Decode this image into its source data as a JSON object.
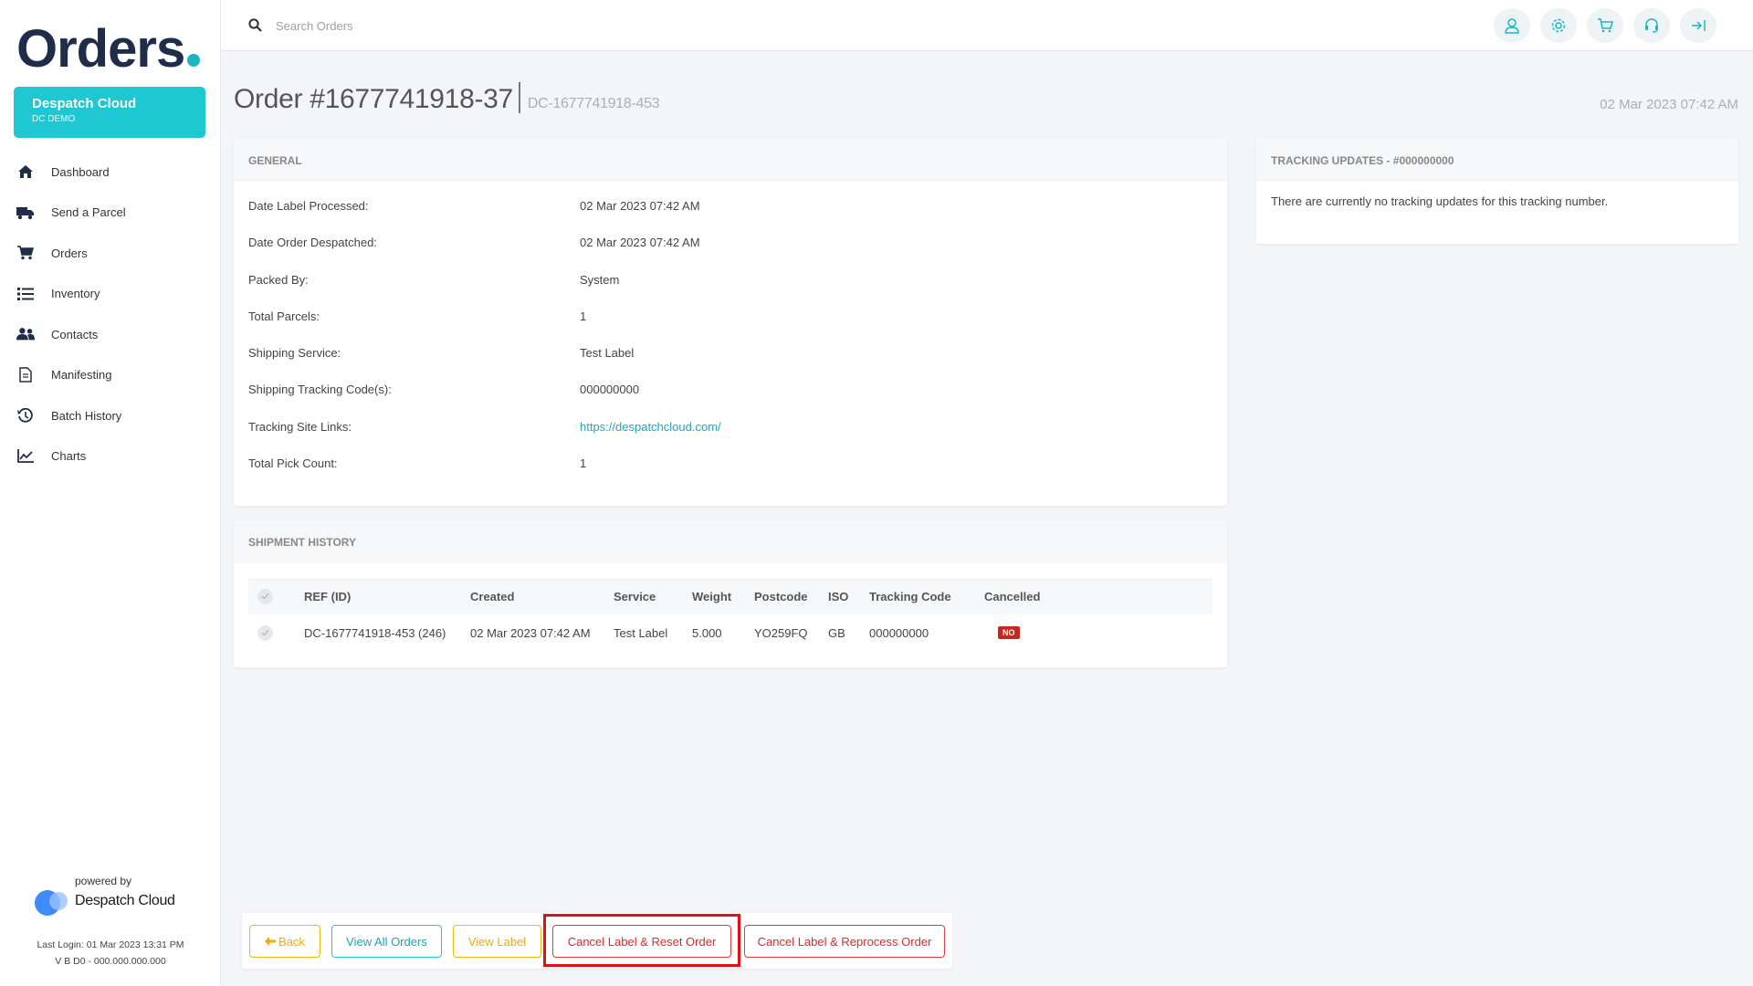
{
  "sidebar": {
    "logo": "Orders",
    "account": {
      "name": "Despatch Cloud",
      "sub": "DC DEMO"
    },
    "items": [
      {
        "label": "Dashboard",
        "icon": "home-icon"
      },
      {
        "label": "Send a Parcel",
        "icon": "truck-icon"
      },
      {
        "label": "Orders",
        "icon": "cart-icon"
      },
      {
        "label": "Inventory",
        "icon": "list-icon"
      },
      {
        "label": "Contacts",
        "icon": "users-icon"
      },
      {
        "label": "Manifesting",
        "icon": "document-icon"
      },
      {
        "label": "Batch History",
        "icon": "history-icon"
      },
      {
        "label": "Charts",
        "icon": "chart-icon"
      }
    ],
    "powered_by": "powered by",
    "brand": "Despatch Cloud",
    "last_login": "Last Login: 01 Mar 2023 13:31 PM",
    "version": "V B D0 - 000.000.000.000"
  },
  "topbar": {
    "search_placeholder": "Search Orders",
    "icons": [
      "user-icon",
      "settings-icon",
      "cart-icon",
      "support-icon",
      "logout-icon"
    ],
    "accent": "#1ec7d2"
  },
  "order": {
    "title": "Order #1677741918-37",
    "dc_ref": "DC-1677741918-453",
    "date": "02 Mar 2023 07:42 AM"
  },
  "general": {
    "heading": "GENERAL",
    "rows": [
      {
        "label": "Date Label Processed:",
        "value": "02 Mar 2023 07:42 AM"
      },
      {
        "label": "Date Order Despatched:",
        "value": "02 Mar 2023 07:42 AM"
      },
      {
        "label": "Packed By:",
        "value": "System"
      },
      {
        "label": "Total Parcels:",
        "value": "1"
      },
      {
        "label": "Shipping Service:",
        "value": "Test Label"
      },
      {
        "label": "Shipping Tracking Code(s):",
        "value": "000000000"
      },
      {
        "label": "Tracking Site Links:",
        "value": "https://despatchcloud.com/"
      },
      {
        "label": "Total Pick Count:",
        "value": "1"
      }
    ]
  },
  "tracking": {
    "heading": "TRACKING UPDATES - #000000000",
    "message": "There are currently no tracking updates for this tracking number."
  },
  "shipment": {
    "heading": "SHIPMENT HISTORY",
    "columns": [
      "REF (ID)",
      "Created",
      "Service",
      "Weight",
      "Postcode",
      "ISO",
      "Tracking Code",
      "Cancelled"
    ],
    "rows": [
      {
        "ref": "DC-1677741918-453 (246)",
        "created": "02 Mar 2023 07:42 AM",
        "service": "Test Label",
        "weight": "5.000",
        "postcode": "YO259FQ",
        "iso": "GB",
        "tracking": "000000000",
        "cancelled": "NO"
      }
    ]
  },
  "actions": {
    "back": "Back",
    "view_all": "View All Orders",
    "view_label": "View Label",
    "cancel_reset": "Cancel Label & Reset Order",
    "cancel_reprocess": "Cancel Label & Reprocess Order"
  }
}
